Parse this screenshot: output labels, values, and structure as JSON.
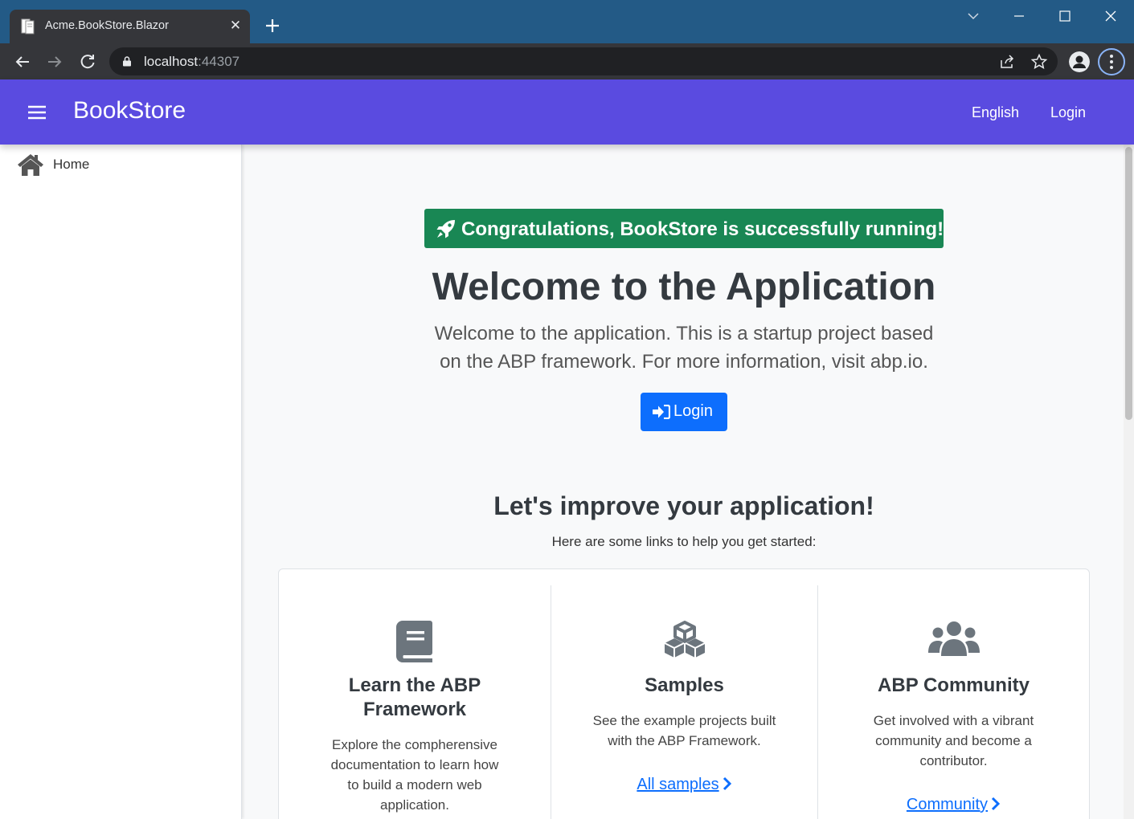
{
  "browser": {
    "tab_title": "Acme.BookStore.Blazor",
    "url_host": "localhost",
    "url_port": ":44307"
  },
  "header": {
    "brand": "BookStore",
    "language": "English",
    "login": "Login"
  },
  "sidebar": {
    "items": [
      {
        "label": "Home",
        "icon": "home-icon"
      }
    ]
  },
  "main": {
    "badge": "Congratulations, BookStore is successfully running!",
    "title": "Welcome to the Application",
    "intro_line1": "Welcome to the application. This is a startup project based",
    "intro_line2": "on the ABP framework. For more information, visit abp.io.",
    "login_button": "Login",
    "improve_title": "Let's improve your application!",
    "improve_sub": "Here are some links to help you get started:"
  },
  "cards": [
    {
      "icon": "book-icon",
      "title_line1": "Learn the ABP",
      "title_line2": "Framework",
      "text_lines": [
        "Explore the compherensive",
        "documentation to learn how",
        "to build a modern web",
        "application."
      ]
    },
    {
      "icon": "cubes-icon",
      "title_line1": "Samples",
      "text_lines": [
        "See the example projects built",
        "with the ABP Framework."
      ],
      "link": "All samples"
    },
    {
      "icon": "users-icon",
      "title_line1": "ABP Community",
      "text_lines": [
        "Get involved with a vibrant",
        "community and become a",
        "contributor."
      ],
      "link": "Community"
    }
  ],
  "colors": {
    "titlebar": "#235a86",
    "app_header": "#5a4be0",
    "success": "#198754",
    "primary": "#0d6efd"
  }
}
